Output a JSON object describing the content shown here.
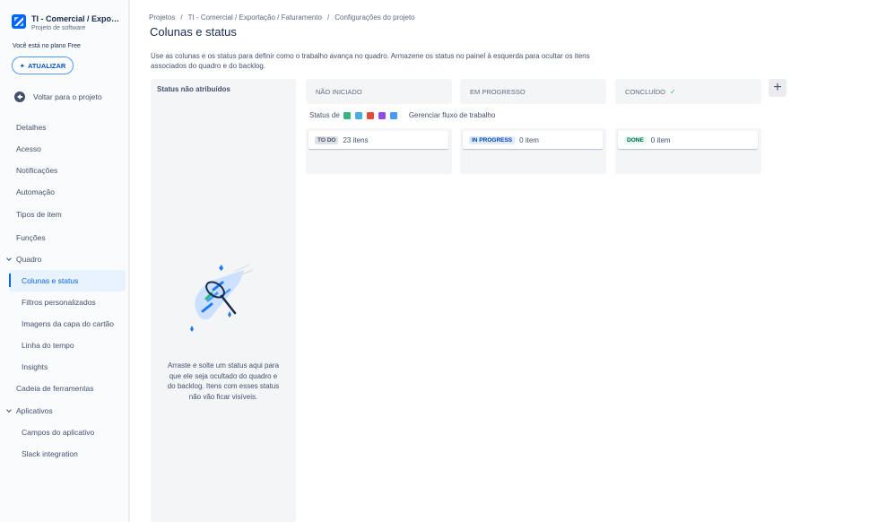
{
  "sidebar": {
    "project_name": "TI - Comercial / Exporta...",
    "project_type": "Projeto de software",
    "plan_text": "Você está no plano Free",
    "upgrade_label": "ATUALIZAR",
    "back_label": "Voltar para o projeto",
    "items": {
      "detalhes": "Detalhes",
      "acesso": "Acesso",
      "notificacoes": "Notificações",
      "automacao": "Automação",
      "tipos": "Tipos de item",
      "funcoes": "Funções",
      "quadro": "Quadro",
      "colunas": "Colunas e status",
      "filtros": "Filtros personalizados",
      "imagens": "Imagens da capa do cartão",
      "linha": "Linha do tempo",
      "insights": "Insights",
      "cadeia": "Cadeia de ferramentas",
      "aplicativos": "Aplicativos",
      "campos": "Campos do aplicativo",
      "slack": "Slack integration"
    }
  },
  "breadcrumb": [
    "Projetos",
    "/",
    "TI - Comercial / Exportação / Faturamento",
    "/",
    "Configurações do projeto"
  ],
  "page": {
    "title": "Colunas e status",
    "description": "Use as colunas e os status para definir como o trabalho avança no quadro. Armazene os status no painel à esquerda para ocultar os itens associados do quadro e do backlog."
  },
  "unassigned": {
    "title": "Status não atribuídos",
    "empty_text": "Arraste e solte um status aqui para que ele seja ocultado do quadro e do backlog. Itens com esses status não vão ficar visíveis."
  },
  "columns": [
    {
      "name": "NÃO INICIADO",
      "status": "TO DO",
      "count": "23 itens"
    },
    {
      "name": "EM PROGRESSO",
      "status": "IN PROGRESS",
      "count": "0 item"
    },
    {
      "name": "CONCLUÍDO",
      "status": "DONE",
      "count": "0 item"
    }
  ],
  "status_of": {
    "label": "Status de",
    "manage_flow": "Gerenciar fluxo de trabalho",
    "type_colors": [
      "#36b37e",
      "#4bade8",
      "#e5493a",
      "#904ee2",
      "#4c9aff"
    ]
  },
  "icons": {
    "project_logo": "project-logo-icon",
    "upgrade": "sparkle-icon",
    "back": "arrow-left-circle-icon",
    "done_check": "check-icon",
    "add_column": "plus-icon"
  }
}
